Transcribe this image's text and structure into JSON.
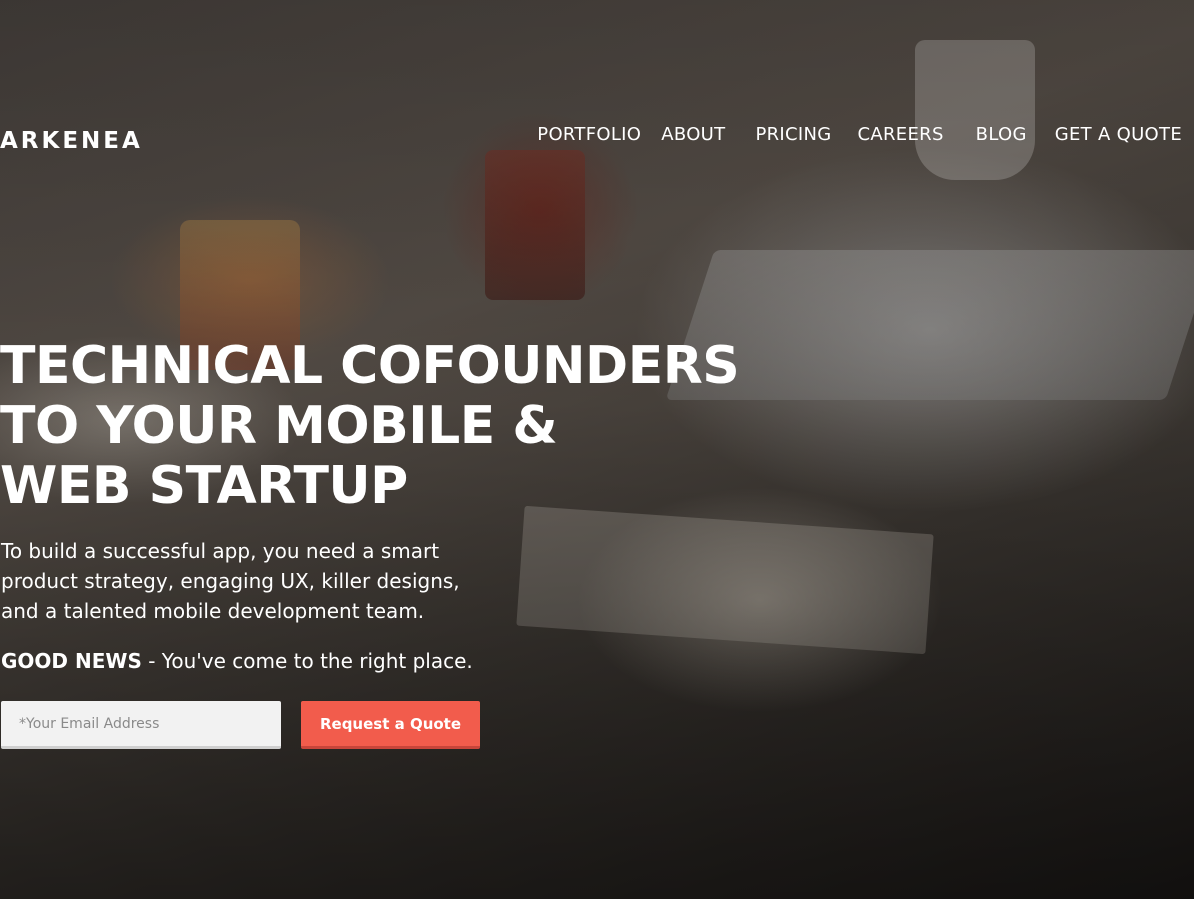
{
  "brand": {
    "logo_text": "ARKENEA"
  },
  "nav": {
    "items": [
      {
        "label": "PORTFOLIO"
      },
      {
        "label": "ABOUT"
      },
      {
        "label": "PRICING"
      },
      {
        "label": "CAREERS"
      },
      {
        "label": "BLOG"
      },
      {
        "label": "GET A QUOTE"
      }
    ]
  },
  "hero": {
    "headline_lines": [
      "TECHNICAL COFOUNDERS",
      "TO YOUR MOBILE &",
      "WEB STARTUP"
    ],
    "intro_lines": [
      "To build a successful app, you need a smart",
      "product strategy, engaging UX, killer designs,",
      "and a talented mobile development team."
    ],
    "good_news_bold": "GOOD NEWS",
    "good_news_rest": " - You've come to the right place."
  },
  "form": {
    "email_placeholder": "*Your Email Address",
    "email_value": "",
    "submit_label": "Request a Quote"
  },
  "colors": {
    "accent": "#f25c4c",
    "text": "#ffffff",
    "input_bg": "#f2f2f2"
  }
}
